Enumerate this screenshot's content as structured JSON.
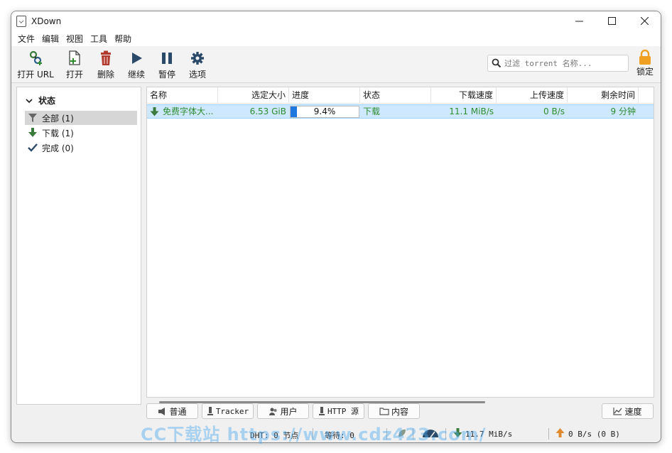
{
  "window": {
    "title": "XDown",
    "minimize": "—",
    "maximize": "☐",
    "close": "✕"
  },
  "menu": [
    "文件",
    "编辑",
    "视图",
    "工具",
    "帮助"
  ],
  "toolbar": {
    "open_url": "打开 URL",
    "open": "打开",
    "delete": "删除",
    "resume": "继续",
    "pause": "暂停",
    "options": "选项",
    "search_placeholder": "过滤 torrent 名称...",
    "lock": "锁定"
  },
  "sidebar": {
    "header": "状态",
    "items": [
      {
        "label": "全部 (1)",
        "icon": "filter-icon"
      },
      {
        "label": "下载 (1)",
        "icon": "download-arrow-icon"
      },
      {
        "label": "完成 (0)",
        "icon": "checkmark-icon"
      }
    ]
  },
  "table": {
    "columns": [
      "名称",
      "选定大小",
      "进度",
      "状态",
      "下载速度",
      "上传速度",
      "剩余时间"
    ],
    "rows": [
      {
        "name": "免费字体大...",
        "size": "6.53 GiB",
        "progress_text": "9.4%",
        "progress": 0.094,
        "status": "下载",
        "down_speed": "11.1 MiB/s",
        "up_speed": "0 B/s",
        "eta": "9 分钟"
      }
    ]
  },
  "tabs": [
    "普通",
    "Tracker",
    "用户",
    "HTTP 源",
    "内容",
    "速度"
  ],
  "statusbar": {
    "dht": "DHT: 0 节点",
    "waiting": "等待: 0",
    "down": "11.7 MiB/s",
    "up": "0 B/s (0 B)"
  },
  "watermark": "CC下载站 https://www.cdz423.com/",
  "colors": {
    "accent": "#1e78e0",
    "downloading_text": "#2e8b2e",
    "selection": "#cde8ff",
    "lock": "#f0a020",
    "delete": "#b03a2e"
  }
}
